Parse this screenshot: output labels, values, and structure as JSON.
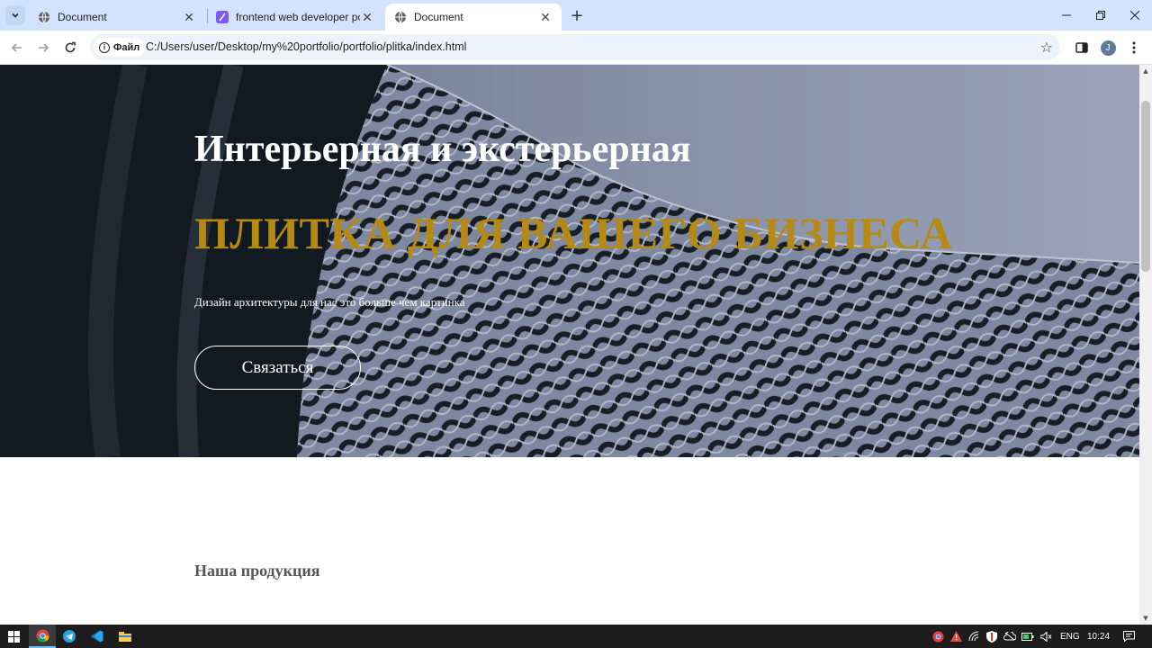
{
  "browser": {
    "tabs": [
      {
        "title": "Document",
        "active": false
      },
      {
        "title": "frontend web developer portfolio",
        "active": false
      },
      {
        "title": "Document",
        "active": true
      }
    ],
    "new_tab_label": "+",
    "address": {
      "chip_label": "Файл",
      "url": "C:/Users/user/Desktop/my%20portfolio/portfolio/plitka/index.html"
    },
    "profile_initial": "J"
  },
  "hero": {
    "subtitle": "Интерьерная и экстерьерная",
    "title": "ПЛИТКА ДЛЯ ВАШЕГО БИЗНЕСА",
    "description": "Дизайн архитектуры для нас это больше чем картинка",
    "button_label": "Связаться",
    "colors": {
      "title": "#b58a14",
      "text": "#ffffff"
    }
  },
  "products": {
    "section_title": "Наша продукция"
  },
  "taskbar": {
    "apps": [
      "windows-start-icon",
      "chrome-icon",
      "telegram-icon",
      "vscode-icon",
      "file-explorer-icon"
    ],
    "language": "ENG",
    "time": "10:24"
  }
}
